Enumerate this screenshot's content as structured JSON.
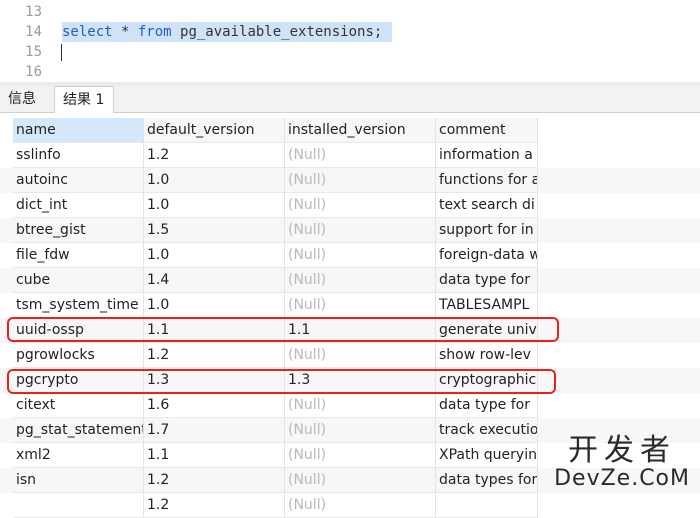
{
  "editor": {
    "line_numbers": [
      "13",
      "14",
      "15",
      "16"
    ],
    "sql_select": "select",
    "sql_star": " * ",
    "sql_from": "from",
    "sql_rest": " pg_available_extensions;"
  },
  "tabs": [
    {
      "label": "信息",
      "active": false
    },
    {
      "label": "结果 1",
      "active": true
    }
  ],
  "grid": {
    "columns": [
      "name",
      "default_version",
      "installed_version",
      "comment"
    ],
    "rows": [
      [
        "sslinfo",
        "1.2",
        "(Null)",
        "information a"
      ],
      [
        "autoinc",
        "1.0",
        "(Null)",
        "functions for a"
      ],
      [
        "dict_int",
        "1.0",
        "(Null)",
        "text search di"
      ],
      [
        "btree_gist",
        "1.5",
        "(Null)",
        "support for in"
      ],
      [
        "file_fdw",
        "1.0",
        "(Null)",
        "foreign-data w"
      ],
      [
        "cube",
        "1.4",
        "(Null)",
        "data type for"
      ],
      [
        "tsm_system_time",
        "1.0",
        "(Null)",
        "TABLESAMPL"
      ],
      [
        "uuid-ossp",
        "1.1",
        "1.1",
        "generate univ"
      ],
      [
        "pgrowlocks",
        "1.2",
        "(Null)",
        "show row-lev"
      ],
      [
        "pgcrypto",
        "1.3",
        "1.3",
        "cryptographic"
      ],
      [
        "citext",
        "1.6",
        "(Null)",
        "data type for"
      ],
      [
        "pg_stat_statements",
        "1.7",
        "(Null)",
        "track executio"
      ],
      [
        "xml2",
        "1.1",
        "(Null)",
        "XPath queryin"
      ],
      [
        "isn",
        "1.2",
        "(Null)",
        "data types for"
      ],
      [
        "",
        "1.2",
        "(Null)",
        ""
      ]
    ],
    "highlighted_rows": [
      "uuid-ossp",
      "pgcrypto"
    ],
    "highlight_color": "#e8241a"
  },
  "watermark": {
    "line1": "开发者",
    "line2": "DevZe.CoM"
  }
}
